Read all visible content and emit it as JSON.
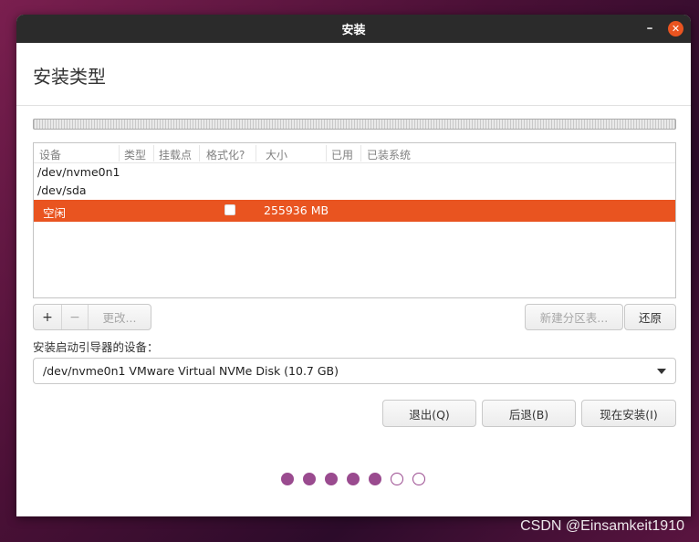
{
  "window": {
    "title": "安装",
    "minimize_glyph": "–",
    "close_glyph": "✕"
  },
  "page": {
    "title": "安装类型"
  },
  "table": {
    "columns": [
      "设备",
      "类型",
      "挂载点",
      "格式化?",
      "大小",
      "已用",
      "已装系统"
    ],
    "rows": [
      {
        "device": "/dev/nvme0n1",
        "type": "",
        "mount": "",
        "format": false,
        "size": "",
        "used": "",
        "os": ""
      },
      {
        "device": "/dev/sda",
        "type": "",
        "mount": "",
        "format": false,
        "size": "",
        "used": "",
        "os": ""
      },
      {
        "device": "空闲",
        "type": "",
        "mount": "",
        "format": false,
        "size": "255936 MB",
        "used": "",
        "os": "",
        "selected": true
      }
    ]
  },
  "buttons": {
    "add": "+",
    "remove": "−",
    "change": "更改...",
    "new_table": "新建分区表...",
    "revert": "还原",
    "quit": "退出(Q)",
    "back": "后退(B)",
    "install_now": "现在安装(I)"
  },
  "bootloader": {
    "label": "安装启动引导器的设备：",
    "selected": "/dev/nvme0n1 VMware Virtual NVMe Disk (10.7 GB)"
  },
  "progress": {
    "total_steps": 7,
    "completed_steps": 5
  },
  "watermark": "CSDN @Einsamkeit1910",
  "colors": {
    "accent": "#e95420",
    "progress": "#9a4b8f",
    "titlebar": "#2b2b2b"
  }
}
